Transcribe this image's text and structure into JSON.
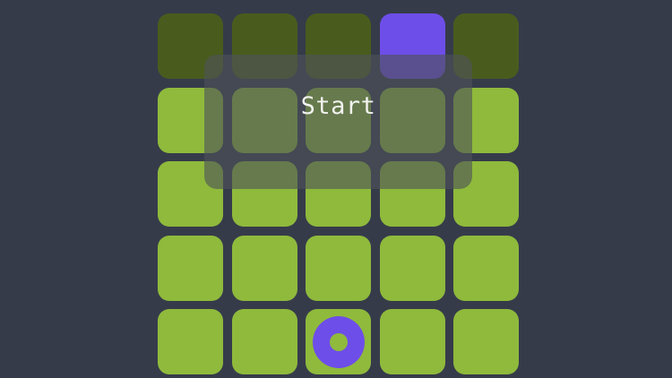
{
  "game": {
    "grid": {
      "rows": 5,
      "cols": 5,
      "active_tile": {
        "row": 0,
        "col": 3
      },
      "target_tile": {
        "row": 4,
        "col": 2
      },
      "tile_color": "#8fba3c",
      "dim_tile_color": "#4a5c1d",
      "active_color": "#6e4ee8"
    },
    "overlay": {
      "start_label": "Start"
    },
    "background_color": "#363b4a"
  }
}
